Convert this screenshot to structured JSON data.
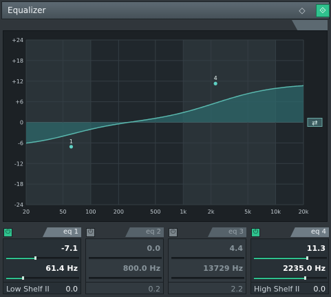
{
  "window": {
    "title": "Equalizer"
  },
  "toolbar": {
    "reset_icon": "◇",
    "active_icon": "⟐"
  },
  "graph": {
    "y_ticks": [
      "+24",
      "+18",
      "+12",
      "+6",
      "0",
      "-6",
      "-12",
      "-18",
      "-24"
    ],
    "x_ticks": [
      "20",
      "50",
      "100",
      "200",
      "500",
      "1k",
      "2k",
      "5k",
      "10k",
      "20k"
    ],
    "loop_icon": "⇄",
    "node_labels": [
      "1",
      "4"
    ]
  },
  "bands": [
    {
      "name": "eq 1",
      "enabled": true,
      "gain": "-7.1",
      "freq": "61.4 Hz",
      "type": "Low Shelf II",
      "q": "0.0",
      "gain_pct": 40,
      "freq_pct": 23
    },
    {
      "name": "eq 2",
      "enabled": false,
      "gain": "0.0",
      "freq": "800.0 Hz",
      "type": "",
      "q": "0.2",
      "gain_pct": 50,
      "freq_pct": 55
    },
    {
      "name": "eq 3",
      "enabled": false,
      "gain": "4.4",
      "freq": "13729 Hz",
      "type": "",
      "q": "2.2",
      "gain_pct": 59,
      "freq_pct": 93
    },
    {
      "name": "eq 4",
      "enabled": true,
      "gain": "11.3",
      "freq": "2235.0 Hz",
      "type": "High Shelf II",
      "q": "0.0",
      "gain_pct": 73,
      "freq_pct": 70
    }
  ]
}
